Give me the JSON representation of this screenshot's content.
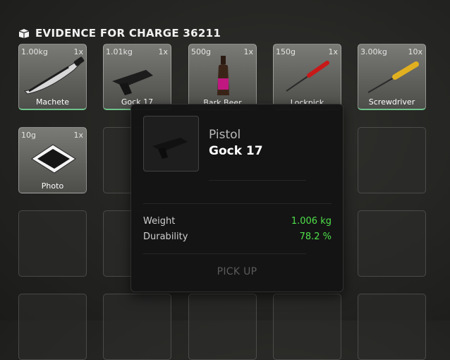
{
  "header": {
    "title": "EVIDENCE FOR CHARGE 36211",
    "icon": "box-icon"
  },
  "inventory": {
    "slots": [
      {
        "weight": "1.00kg",
        "qty": "1x",
        "name": "Machete",
        "icon": "machete-icon"
      },
      {
        "weight": "1.01kg",
        "qty": "1x",
        "name": "Gock 17",
        "icon": "pistol-icon"
      },
      {
        "weight": "500g",
        "qty": "1x",
        "name": "Bark Beer",
        "icon": "bottle-icon"
      },
      {
        "weight": "150g",
        "qty": "1x",
        "name": "Lockpick",
        "icon": "lockpick-icon"
      },
      {
        "weight": "3.00kg",
        "qty": "10x",
        "name": "Screwdriver",
        "icon": "screwdriver-icon"
      },
      {
        "weight": "10g",
        "qty": "1x",
        "name": "Photo",
        "icon": "photo-icon"
      }
    ]
  },
  "tooltip": {
    "category": "Pistol",
    "name": "Gock 17",
    "stats": [
      {
        "label": "Weight",
        "value": "1.006 kg"
      },
      {
        "label": "Durability",
        "value": "78.2 %"
      }
    ],
    "action": "PICK UP",
    "value_color": "#4fe04a"
  },
  "colors": {
    "accent_green": "#6ec48a"
  }
}
